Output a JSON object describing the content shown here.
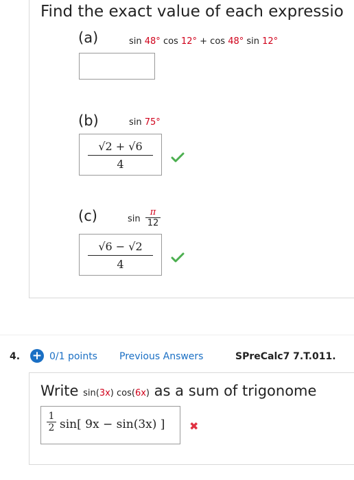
{
  "question3": {
    "heading": "Find the exact value of each expressio",
    "parts": [
      {
        "label": "(a)",
        "expr": {
          "f1": "sin ",
          "a1": "48°",
          "f2": " cos ",
          "a2": "12°",
          "op": " + ",
          "f3": "cos ",
          "a3": "48°",
          "f4": " sin ",
          "a4": "12°"
        },
        "answer": ""
      },
      {
        "label": "(b)",
        "expr": {
          "f1": "sin ",
          "a1": "75°"
        },
        "answer_num": "√2 + √6",
        "answer_den": "4",
        "status": "correct"
      },
      {
        "label": "(c)",
        "expr": {
          "f1": "sin ",
          "num": "π",
          "den": "12"
        },
        "answer_num": "√6 − √2",
        "answer_den": "4",
        "status": "correct"
      }
    ]
  },
  "question4": {
    "number": "4.",
    "points": "0/1 points",
    "previous_answers": "Previous Answers",
    "code": "SPreCalc7 7.T.011.",
    "prompt_start": "Write ",
    "prompt_expr": {
      "f1": "sin(",
      "a1": "3x",
      "f2": ") cos(",
      "a2": "6x",
      "f3": ")"
    },
    "prompt_end": " as a sum of trigonome",
    "answer": {
      "coef_num": "1",
      "coef_den": "2",
      "body": "sin[ 9x − sin(3x) ]"
    },
    "status": "incorrect"
  },
  "colors": {
    "link": "#1a6fc4",
    "highlight": "#d0021b",
    "correct": "#4caf50",
    "incorrect": "#e03040"
  },
  "icons": {
    "correct": "check-icon",
    "incorrect": "x-icon",
    "expand": "plus-circle-icon"
  }
}
